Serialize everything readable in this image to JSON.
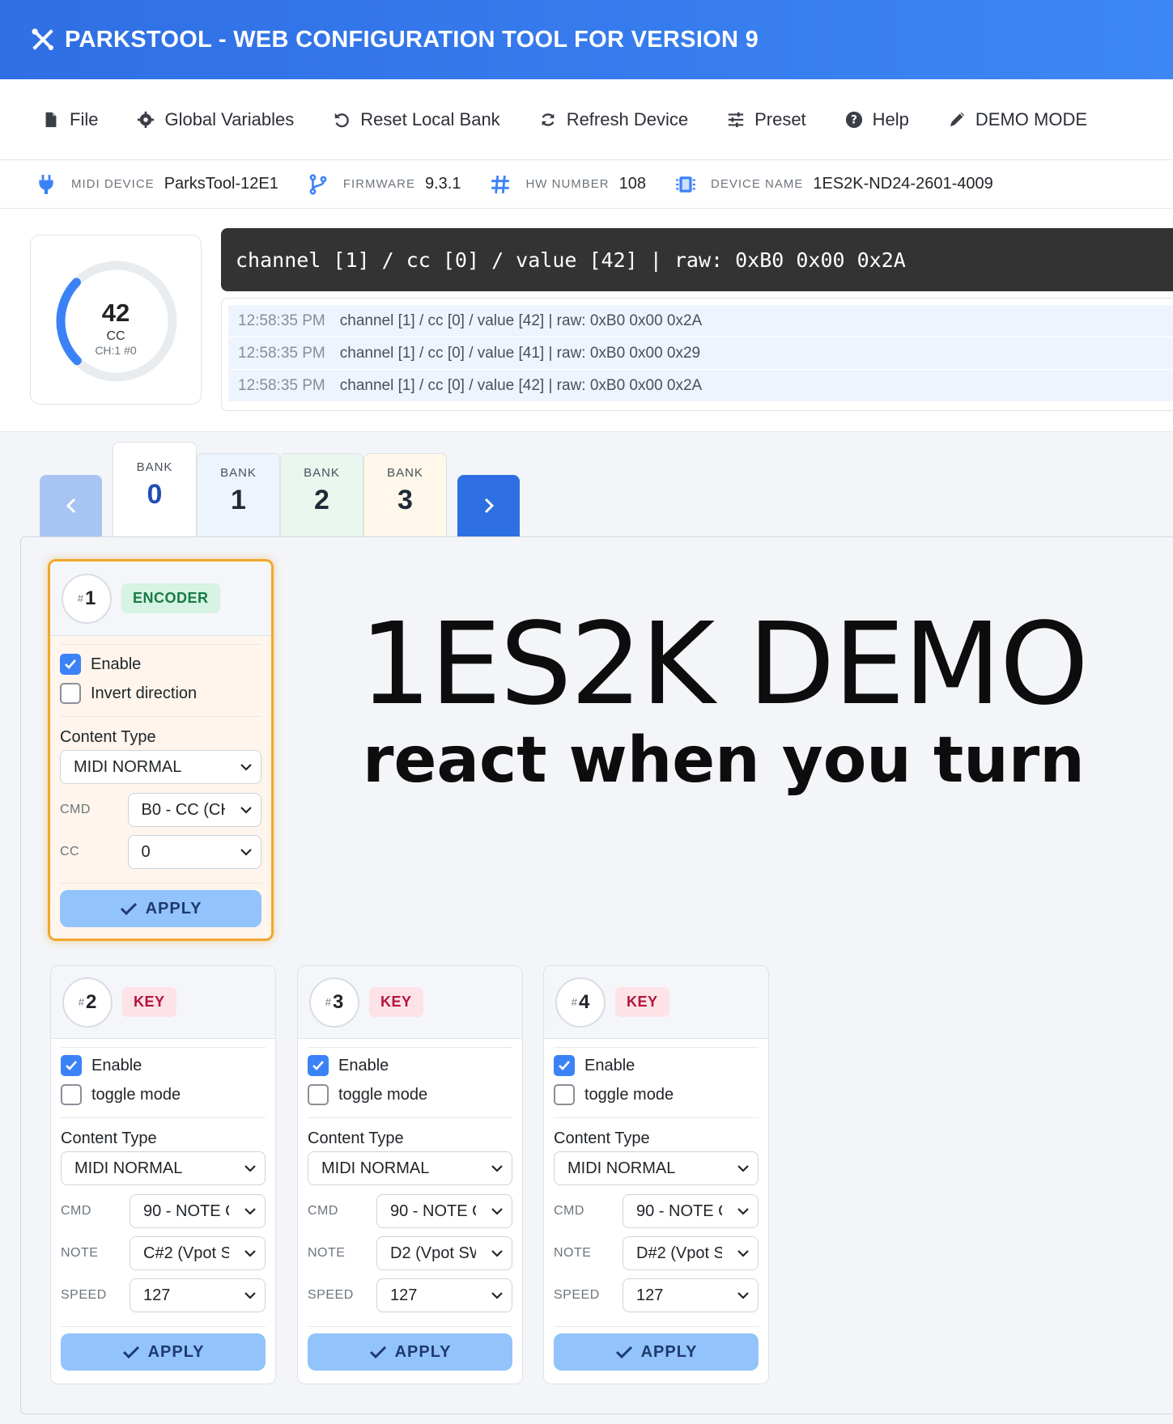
{
  "app": {
    "title": "PARKSTOOL - WEB CONFIGURATION TOOL FOR VERSION 9"
  },
  "menu": {
    "file": "File",
    "global_variables": "Global Variables",
    "reset_local_bank": "Reset Local Bank",
    "refresh_device": "Refresh Device",
    "preset": "Preset",
    "help": "Help",
    "demo_mode": "DEMO MODE"
  },
  "device": {
    "midi_device_label": "MIDI DEVICE",
    "midi_device": "ParksTool-12E1",
    "firmware_label": "FIRMWARE",
    "firmware": "9.3.1",
    "hw_number_label": "HW NUMBER",
    "hw_number": "108",
    "device_name_label": "DEVICE NAME",
    "device_name": "1ES2K-ND24-2601-4009"
  },
  "gauge": {
    "value": "42",
    "type": "CC",
    "channel": "CH:1 #0",
    "fraction": 0.33
  },
  "monitor": {
    "current": "channel [1] / cc [0] / value [42] | raw: 0xB0 0x00 0x2A",
    "log": [
      {
        "time": "12:58:35 PM",
        "message": "channel [1] / cc [0] / value [42] | raw: 0xB0 0x00 0x2A"
      },
      {
        "time": "12:58:35 PM",
        "message": "channel [1] / cc [0] / value [41] | raw: 0xB0 0x00 0x29"
      },
      {
        "time": "12:58:35 PM",
        "message": "channel [1] / cc [0] / value [42] | raw: 0xB0 0x00 0x2A"
      }
    ]
  },
  "banks": {
    "label": "BANK",
    "tabs": [
      {
        "label": "BANK",
        "number": "0",
        "color": "#ffffff"
      },
      {
        "label": "BANK",
        "number": "1",
        "color": "#eef4fd"
      },
      {
        "label": "BANK",
        "number": "2",
        "color": "#eaf7ef"
      },
      {
        "label": "BANK",
        "number": "3",
        "color": "#fff8ea"
      }
    ],
    "active": 0
  },
  "demo": {
    "title": "1ES2K DEMO",
    "subtitle": "react when you turn"
  },
  "controls": [
    {
      "hash": "#",
      "number": "1",
      "type": "ENCODER",
      "enable_label": "Enable",
      "enable": true,
      "option_label": "Invert direction",
      "option": false,
      "content_type_label": "Content Type",
      "content_type": "MIDI NORMAL",
      "params": [
        {
          "label": "CMD",
          "value": "B0 - CC (CH"
        },
        {
          "label": "CC",
          "value": "0"
        }
      ],
      "apply": "APPLY"
    },
    {
      "hash": "#",
      "number": "2",
      "type": "KEY",
      "enable_label": "Enable",
      "enable": true,
      "option_label": "toggle mode",
      "option": false,
      "content_type_label": "Content Type",
      "content_type": "MIDI NORMAL",
      "params": [
        {
          "label": "CMD",
          "value": "90 - NOTE C"
        },
        {
          "label": "NOTE",
          "value": "C#2 (Vpot S\\"
        },
        {
          "label": "SPEED",
          "value": "127"
        }
      ],
      "apply": "APPLY"
    },
    {
      "hash": "#",
      "number": "3",
      "type": "KEY",
      "enable_label": "Enable",
      "enable": true,
      "option_label": "toggle mode",
      "option": false,
      "content_type_label": "Content Type",
      "content_type": "MIDI NORMAL",
      "params": [
        {
          "label": "CMD",
          "value": "90 - NOTE C"
        },
        {
          "label": "NOTE",
          "value": "D2 (Vpot SW"
        },
        {
          "label": "SPEED",
          "value": "127"
        }
      ],
      "apply": "APPLY"
    },
    {
      "hash": "#",
      "number": "4",
      "type": "KEY",
      "enable_label": "Enable",
      "enable": true,
      "option_label": "toggle mode",
      "option": false,
      "content_type_label": "Content Type",
      "content_type": "MIDI NORMAL",
      "params": [
        {
          "label": "CMD",
          "value": "90 - NOTE C"
        },
        {
          "label": "NOTE",
          "value": "D#2 (Vpot S\\"
        },
        {
          "label": "SPEED",
          "value": "127"
        }
      ],
      "apply": "APPLY"
    }
  ],
  "colors": {
    "header": "#2f6fe4",
    "accent": "#3b82f6",
    "selected_border": "#f0a82c",
    "apply": "#93c3fb"
  }
}
